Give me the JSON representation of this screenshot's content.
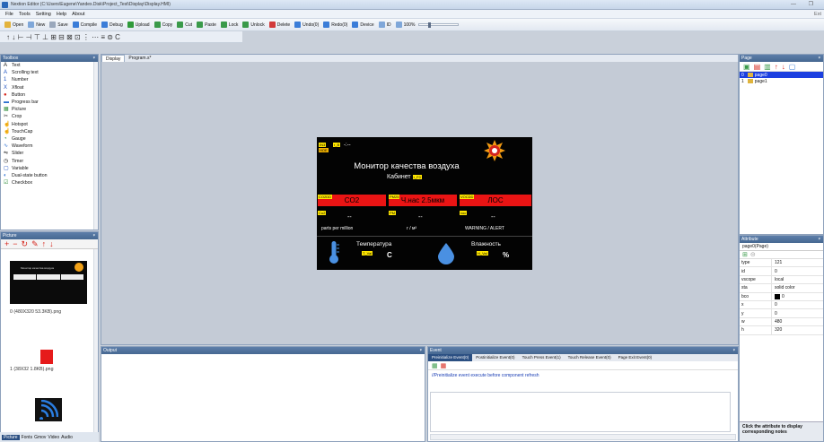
{
  "window": {
    "title": "Nextion Editor (C:\\Users\\Eugene\\Yandex.Disk\\Project_Test\\Display\\Display.HMI)",
    "controls": "— ❐"
  },
  "menu": {
    "items": [
      "File",
      "Tools",
      "Setting",
      "Help",
      "About"
    ],
    "hint": "Ext"
  },
  "toolbar": {
    "items": [
      {
        "label": "Open",
        "color": "#e3b33c"
      },
      {
        "label": "New",
        "color": "#7fa7d9"
      },
      {
        "label": "Save",
        "color": "#9aa8bc"
      },
      {
        "label": "Compile",
        "color": "#3b7dd8"
      },
      {
        "label": "Debug",
        "color": "#3b7dd8"
      },
      {
        "label": "Upload",
        "color": "#2f9a3a"
      },
      {
        "label": "Copy",
        "color": "#3a9a4a"
      },
      {
        "label": "Cut",
        "color": "#3a9a4a"
      },
      {
        "label": "Paste",
        "color": "#3a9a4a"
      },
      {
        "label": "Lock",
        "color": "#3a9a4a"
      },
      {
        "label": "Unlock",
        "color": "#3a9a4a"
      },
      {
        "label": "Delete",
        "color": "#d23a3a"
      },
      {
        "label": "Undo(0)",
        "color": "#3b7dd8"
      },
      {
        "label": "Redo(0)",
        "color": "#3b7dd8"
      },
      {
        "label": "Device",
        "color": "#3b7dd8"
      },
      {
        "label": "ID",
        "color": "#7fa7d9"
      },
      {
        "label": "100%",
        "color": "#7fa7d9"
      }
    ],
    "align_glyphs": "↑ ↓ ⊢ ⊣ ⊤ ⊥ ⊞ ⊟ ⊠ ⊡ ⋮ ⋯ ≡ ⊜ C"
  },
  "toolbox": {
    "title": "Toolbox",
    "pin": "ᵠ",
    "items": [
      {
        "label": "Text",
        "icon": "A",
        "icon_name": "text-icon",
        "color": "#111"
      },
      {
        "label": "Scrolling text",
        "icon": "A",
        "icon_name": "scrolling-text-icon",
        "color": "#1b50c0"
      },
      {
        "label": "Number",
        "icon": "1",
        "icon_name": "number-icon",
        "color": "#1b50c0"
      },
      {
        "label": "Xfloat",
        "icon": "X",
        "icon_name": "xfloat-icon",
        "color": "#1b50c0"
      },
      {
        "label": "Button",
        "icon": "●",
        "icon_name": "button-icon",
        "color": "#d6261c"
      },
      {
        "label": "Progress bar",
        "icon": "▬",
        "icon_name": "progress-bar-icon",
        "color": "#2b6fd0"
      },
      {
        "label": "Picture",
        "icon": "▦",
        "icon_name": "picture-icon",
        "color": "#2f8d3a"
      },
      {
        "label": "Crop",
        "icon": "✂",
        "icon_name": "crop-icon",
        "color": "#333"
      },
      {
        "label": "Hotspot",
        "icon": "☝",
        "icon_name": "hotspot-icon",
        "color": "#333"
      },
      {
        "label": "TouchCap",
        "icon": "☝",
        "icon_name": "touchcap-icon",
        "color": "#333"
      },
      {
        "label": "Gauge",
        "icon": "◔",
        "icon_name": "gauge-icon",
        "color": "#2f8d3a"
      },
      {
        "label": "Waveform",
        "icon": "∿",
        "icon_name": "waveform-icon",
        "color": "#2b6fd0"
      },
      {
        "label": "Slider",
        "icon": "⇋",
        "icon_name": "slider-icon",
        "color": "#333"
      },
      {
        "label": "Timer",
        "icon": "◷",
        "icon_name": "timer-icon",
        "color": "#111"
      },
      {
        "label": "Variable",
        "icon": "▢",
        "icon_name": "variable-icon",
        "color": "#1b50c0"
      },
      {
        "label": "Dual-state button",
        "icon": "◐",
        "icon_name": "dual-state-button-icon",
        "color": "#2b6fd0"
      },
      {
        "label": "Checkbox",
        "icon": "☑",
        "icon_name": "checkbox-icon",
        "color": "#2f8d3a"
      }
    ]
  },
  "picture_panel": {
    "title": "Picture",
    "tools": [
      "+",
      "−",
      "↻",
      "✎",
      "↑",
      "↓"
    ],
    "images": [
      {
        "label": "0  (480X320 53.3KB).png"
      },
      {
        "label": "1  (38X32 1.8KB).png"
      }
    ]
  },
  "bottom_tabs": [
    "Picture",
    "Fonts",
    "Gmov",
    "Video",
    "Audio"
  ],
  "display": {
    "tabs": [
      "Display",
      "Program.s*"
    ],
    "screen": {
      "title": "Монитор качества воздуха",
      "subtitle": "Кабинет",
      "top_tag_a": "IN3",
      "top_tag_b": "HOE",
      "top_tag_c": "r_B",
      "top_text": "-:--",
      "sub_tag": "r_F0",
      "co2_tag": "CO2DD",
      "co2_label": "CO2",
      "pm_tag": "PM25",
      "pm_label": "Ч.нас 2.5мкм",
      "voc_tag": "VOCDD",
      "voc_label": "ЛОС",
      "co2_value_tag": "Co2",
      "co2_value": "--",
      "pm_value_tag": "PM",
      "pm_value": "--",
      "voc_value_tag": "voc",
      "voc_value": "--",
      "co2_unit": "parts per million",
      "pm_unit": "г / м³",
      "voc_unit": "WARNING / ALERT",
      "temp_label": "Температура",
      "temp_tag": "T_Val",
      "temp_unit": "C",
      "hum_label": "Влажность",
      "hum_tag": "H_Val",
      "hum_unit": "%"
    }
  },
  "page_panel": {
    "title": "Page",
    "pages": [
      "page0",
      "page1"
    ],
    "page_numbers": [
      "0",
      "1"
    ]
  },
  "attribute_panel": {
    "title": "Attribute",
    "component": "page0(Page)",
    "rows": [
      {
        "key": "type",
        "value": "121"
      },
      {
        "key": "id",
        "value": "0"
      },
      {
        "key": "vscope",
        "value": "local"
      },
      {
        "key": "sta",
        "value": "solid color"
      },
      {
        "key": "bco",
        "value": "0"
      },
      {
        "key": "x",
        "value": "0"
      },
      {
        "key": "y",
        "value": "0"
      },
      {
        "key": "w",
        "value": "480"
      },
      {
        "key": "h",
        "value": "320"
      }
    ],
    "note": "Click the attribute to display corresponding notes"
  },
  "output_panel": {
    "title": "Output"
  },
  "event_panel": {
    "title": "Event",
    "tabs": [
      "Preinitialize Event(0)",
      "Postinitialize Event(0)",
      "Touch Press Event(1)",
      "Touch Release Event(0)",
      "Page Exit Event(0)"
    ],
    "description": "//Preinitialize event execute before component refresh"
  }
}
